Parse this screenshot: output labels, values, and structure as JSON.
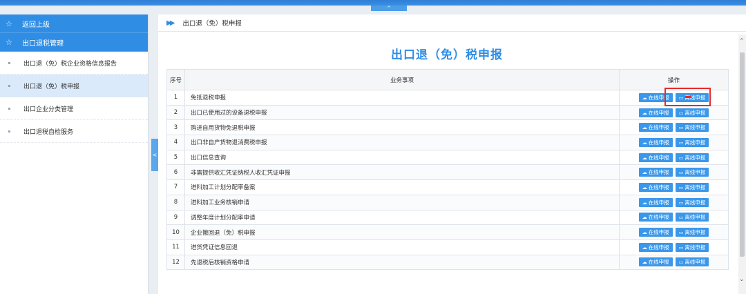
{
  "topbar": {
    "collapse_glyph": "^"
  },
  "sidebar": {
    "headers": [
      {
        "icon": "star-icon",
        "label": "返回上级"
      },
      {
        "icon": "star-icon",
        "label": "出口退税管理"
      }
    ],
    "items": [
      {
        "label": "出口退（免）税企业资格信息报告",
        "active": false
      },
      {
        "label": "出口退（免）税申报",
        "active": true
      },
      {
        "label": "出口企业分类管理",
        "active": false
      },
      {
        "label": "出口退税自检服务",
        "active": false
      }
    ],
    "toggle_glyph": "<"
  },
  "breadcrumb": "出口退（免）税申报",
  "page_title": "出口退（免）税申报",
  "table": {
    "headers": [
      "序号",
      "业务事项",
      "操作"
    ],
    "online_label": "在线申报",
    "offline_label": "离线申报",
    "rows": [
      {
        "no": "1",
        "name": "免抵退税申报"
      },
      {
        "no": "2",
        "name": "出口已使用过的设备退税申报"
      },
      {
        "no": "3",
        "name": "购进自用货物免退税申报"
      },
      {
        "no": "4",
        "name": "出口非自产货物退消费税申报"
      },
      {
        "no": "5",
        "name": "出口信息查询"
      },
      {
        "no": "6",
        "name": "非需提供收汇凭证纳税人收汇凭证申报"
      },
      {
        "no": "7",
        "name": "进料加工计划分配率备案"
      },
      {
        "no": "8",
        "name": "进料加工业务核销申请"
      },
      {
        "no": "9",
        "name": "调整年度计划分配率申请"
      },
      {
        "no": "10",
        "name": "企业撤回退（免）税申报"
      },
      {
        "no": "11",
        "name": "进货凭证信息回退"
      },
      {
        "no": "12",
        "name": "先退税后核销资格申请"
      }
    ]
  },
  "colors": {
    "accent": "#2f8de4",
    "highlight": "#e52a2a"
  }
}
